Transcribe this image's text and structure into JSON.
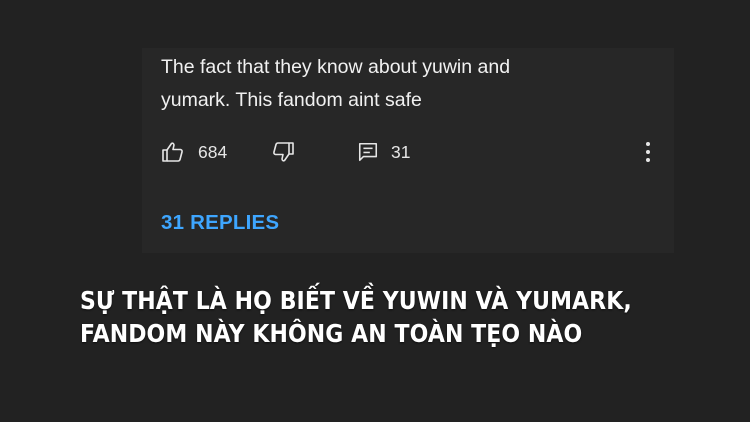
{
  "comment": {
    "text_line1": "The fact that they know about yuwin and",
    "text_line2": "yumark. This fandom aint safe",
    "like_count": "684",
    "reply_count": "31",
    "replies_label": "31 REPLIES",
    "icons": {
      "like": "thumbs-up-icon",
      "dislike": "thumbs-down-icon",
      "reply": "comment-icon",
      "more": "more-vertical-icon"
    }
  },
  "caption": {
    "line1": "SỰ THẬT LÀ HỌ BIẾT VỀ YUWIN VÀ YUMARK,",
    "line2": "FANDOM NÀY KHÔNG AN TOÀN TẸO NÀO"
  },
  "colors": {
    "background": "#222222",
    "card": "#272727",
    "text": "#f1f1f1",
    "link": "#3ea6ff",
    "caption": "#ffffff"
  }
}
